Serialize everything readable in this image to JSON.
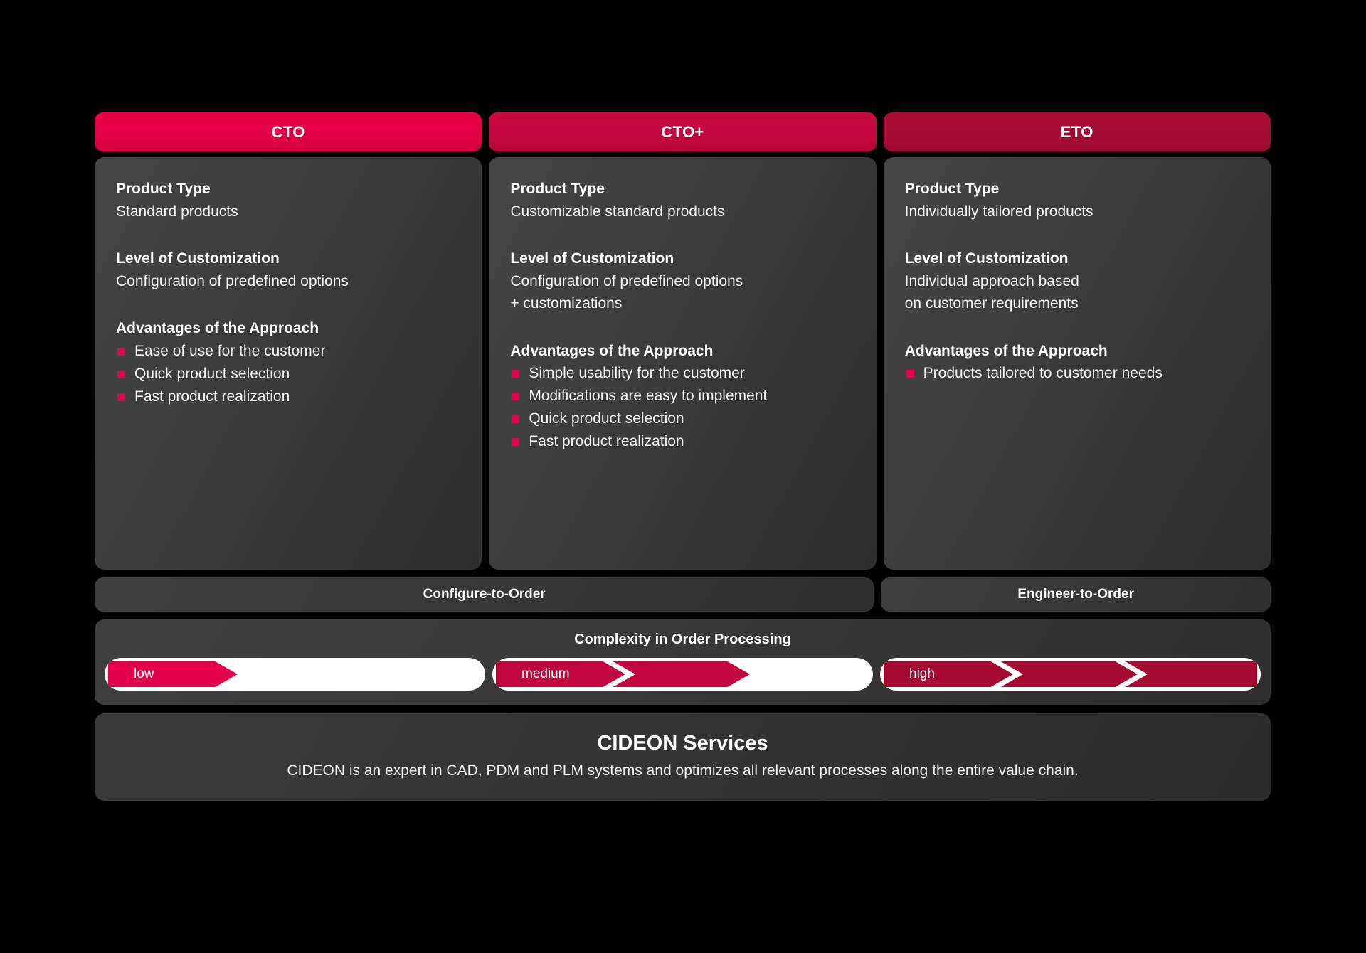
{
  "colors": {
    "accent_bright": "#e4004b",
    "accent_mid": "#c1063f",
    "accent_dark": "#a50a33",
    "panel": "#3a3a3a",
    "background": "#000000",
    "text": "#ffffff"
  },
  "columns": [
    {
      "tab_label": "CTO",
      "product_type_label": "Product Type",
      "product_type_value": "Standard products",
      "customization_label": "Level of Customization",
      "customization_value": [
        "Configuration of predefined options"
      ],
      "advantages_label": "Advantages of the Approach",
      "advantages": [
        "Ease of use for the customer",
        "Quick product selection",
        "Fast product realization"
      ]
    },
    {
      "tab_label": "CTO+",
      "product_type_label": "Product Type",
      "product_type_value": "Customizable standard products",
      "customization_label": "Level of Customization",
      "customization_value": [
        "Configuration of predefined options",
        "+ customizations"
      ],
      "advantages_label": "Advantages of the Approach",
      "advantages": [
        "Simple usability for the customer",
        "Modifications are easy to implement",
        "Quick product selection",
        "Fast product realization"
      ]
    },
    {
      "tab_label": "ETO",
      "product_type_label": "Product Type",
      "product_type_value": "Individually tailored products",
      "customization_label": "Level of Customization",
      "customization_value": [
        "Individual approach based",
        "on customer requirements"
      ],
      "advantages_label": "Advantages of the Approach",
      "advantages": [
        "Products tailored to customer needs"
      ]
    }
  ],
  "order_strip": [
    {
      "label": "Configure-to-Order",
      "span": 2
    },
    {
      "label": "Engineer-to-Order",
      "span": 1
    }
  ],
  "complexity": {
    "title": "Complexity in Order Processing",
    "meters": [
      {
        "label": "low",
        "filled_segments": 1,
        "total_segments": 3,
        "color": "#e4004b"
      },
      {
        "label": "medium",
        "filled_segments": 2,
        "total_segments": 3,
        "color": "#c1063f"
      },
      {
        "label": "high",
        "filled_segments": 3,
        "total_segments": 3,
        "color": "#a50a33"
      }
    ]
  },
  "services": {
    "title": "CIDEON Services",
    "text": "CIDEON is an expert in CAD, PDM and PLM systems and optimizes all relevant processes along the entire value chain."
  },
  "chart_data": {
    "type": "table",
    "title": "CTO / CTO+ / ETO comparison",
    "categories": [
      "CTO",
      "CTO+",
      "ETO"
    ],
    "series": [
      {
        "name": "Complexity in Order Processing",
        "values": [
          1,
          2,
          3
        ],
        "labels": [
          "low",
          "medium",
          "high"
        ]
      }
    ]
  }
}
